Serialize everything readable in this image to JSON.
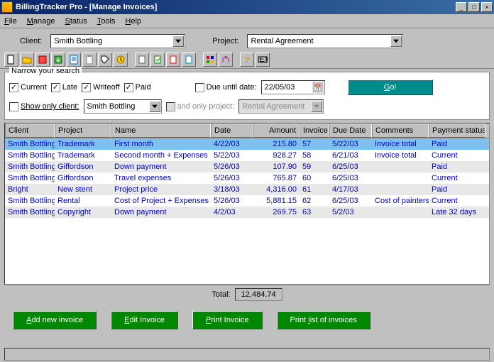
{
  "title": "BillingTracker Pro - [Manage Invoices]",
  "menu": [
    "File",
    "Manage",
    "Status",
    "Tools",
    "Help"
  ],
  "filters": {
    "client_label": "Client:",
    "client_value": "Smith Bottling",
    "project_label": "Project:",
    "project_value": "Rental Agreement"
  },
  "toolbar_icons": [
    "new-doc",
    "folder",
    "import",
    "import2",
    "note",
    "clipboard",
    "tag",
    "clock",
    "paste1",
    "paste2",
    "paste3",
    "paste4",
    "grid",
    "wand",
    "help",
    "exit"
  ],
  "narrow": {
    "legend": "Narrow your search",
    "current": "Current",
    "late": "Late",
    "writeoff": "Writeoff",
    "paid": "Paid",
    "due_label": "Due until date:",
    "due_value": "22/05/03",
    "go": "Go!",
    "show_only_client": "Show only client:",
    "show_client_value": "Smith Bottling",
    "and_project": "and only project:",
    "and_project_value": "Rental Agreement"
  },
  "columns": [
    "Client",
    "Project",
    "Name",
    "Date",
    "Amount",
    "Invoice",
    "Due Date",
    "Comments",
    "Payment status"
  ],
  "rows": [
    {
      "client": "Smith Bottling",
      "project": "Trademark",
      "name": "First month",
      "date": "4/22/03",
      "amount": "215.80",
      "invoice": "57",
      "due": "5/22/03",
      "comments": "Invoice total",
      "status": "Paid",
      "sel": true
    },
    {
      "client": "Smith Bottling",
      "project": "Trademark",
      "name": "Second month + Expenses",
      "date": "5/22/03",
      "amount": "928.27",
      "invoice": "58",
      "due": "6/21/03",
      "comments": "Invoice total",
      "status": "Current"
    },
    {
      "client": "Smith Bottling",
      "project": "Giffordson",
      "name": "Down payment",
      "date": "5/26/03",
      "amount": "107.90",
      "invoice": "59",
      "due": "6/25/03",
      "comments": "",
      "status": "Paid"
    },
    {
      "client": "Smith Bottling",
      "project": "Giffordson",
      "name": "Travel expenses",
      "date": "5/26/03",
      "amount": "765.87",
      "invoice": "60",
      "due": "6/25/03",
      "comments": "",
      "status": "Current"
    },
    {
      "client": "Bright",
      "project": "New stent",
      "name": "Project price",
      "date": "3/18/03",
      "amount": "4,316.00",
      "invoice": "61",
      "due": "4/17/03",
      "comments": "",
      "status": "Paid"
    },
    {
      "client": "Smith Bottling",
      "project": "Rental",
      "name": "Cost of Project + Expenses",
      "date": "5/26/03",
      "amount": "5,881.15",
      "invoice": "62",
      "due": "6/25/03",
      "comments": "Cost of painters",
      "status": "Current"
    },
    {
      "client": "Smith Bottling",
      "project": "Copyright",
      "name": "Down payment",
      "date": "4/2/03",
      "amount": "269.75",
      "invoice": "63",
      "due": "5/2/03",
      "comments": "",
      "status": "Late 32 days"
    }
  ],
  "total_label": "Total:",
  "total_value": "12,484.74",
  "buttons": {
    "add": "Add new invoice",
    "edit": "Edit Invoice",
    "print": "Print Invoice",
    "printlist": "Print list of invoices"
  }
}
